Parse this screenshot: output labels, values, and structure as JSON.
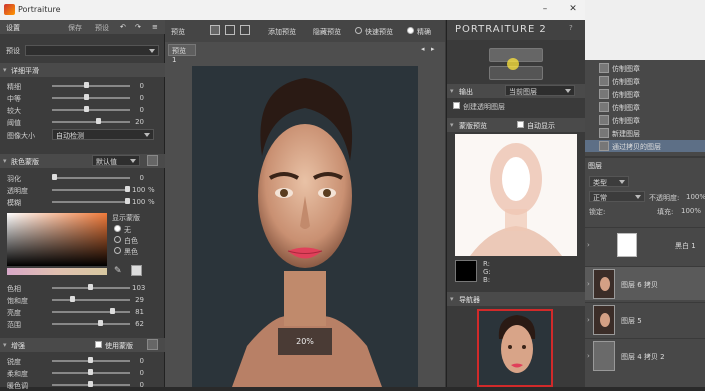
{
  "window": {
    "title": "Portraiture"
  },
  "left_panel": {
    "header_title": "设置",
    "header_btn1": "保存",
    "header_btn2": "预设",
    "preset_label": "预设",
    "detail_section": "详细平滑",
    "sliders": [
      {
        "label": "精细",
        "value": "0"
      },
      {
        "label": "中等",
        "value": "0"
      },
      {
        "label": "较大",
        "value": "0"
      },
      {
        "label": "阈值",
        "value": "20"
      }
    ],
    "patch_size_label": "图像大小",
    "patch_size_value": "自动检测",
    "skin_section": "肤色蒙版",
    "skin_default": "默认值",
    "skin_sliders": [
      {
        "label": "羽化",
        "value": "0"
      },
      {
        "label": "透明度",
        "value": "100",
        "unit": "%"
      },
      {
        "label": "模糊",
        "value": "100",
        "unit": "%"
      }
    ],
    "display_mask_label": "显示蒙版",
    "radio_opts": [
      "无",
      "白色",
      "黑色"
    ],
    "color_sliders": [
      {
        "label": "色相",
        "value": "103"
      },
      {
        "label": "饱和度",
        "value": "29"
      },
      {
        "label": "亮度",
        "value": "81"
      },
      {
        "label": "范围",
        "value": "62"
      }
    ],
    "enhance_section": "增强",
    "use_mask_label": "使用蒙版",
    "enhance_sliders": [
      {
        "label": "锐度",
        "value": "0"
      },
      {
        "label": "柔和度",
        "value": "0"
      },
      {
        "label": "暖色调",
        "value": "0"
      }
    ]
  },
  "middle": {
    "header": "预览",
    "add_preview": "添加预览",
    "hide_preview": "隐藏预览",
    "fast_preview": "快速预览",
    "fine": "精确",
    "tab": "预览 1",
    "zoom": "20%"
  },
  "right_panel": {
    "brand": "PORTRAITURE 2",
    "output_label": "输出",
    "output_value": "当前图层",
    "create_transparent": "创建透明图层",
    "mask_preview": "蒙版预览",
    "auto_show": "自动显示",
    "navigator": "导航器",
    "sample_r": "R:",
    "sample_g": "G:",
    "sample_b": "B:"
  },
  "ps_panel": {
    "layers_top": [
      "仿制图章",
      "仿制图章",
      "仿制图章",
      "仿制图章",
      "仿制图章",
      "新建图层",
      "通过拷贝的图层"
    ],
    "tab": "图层",
    "kind": "类型",
    "mode": "正常",
    "opacity_label": "不透明度:",
    "opacity": "100%",
    "lock_label": "锁定:",
    "fill_label": "填充:",
    "fill": "100%",
    "layers": [
      {
        "name": "黑白 1"
      },
      {
        "name": "图层 6 拷贝"
      },
      {
        "name": "图层 5"
      },
      {
        "name": "图层 4 拷贝 2"
      }
    ]
  }
}
